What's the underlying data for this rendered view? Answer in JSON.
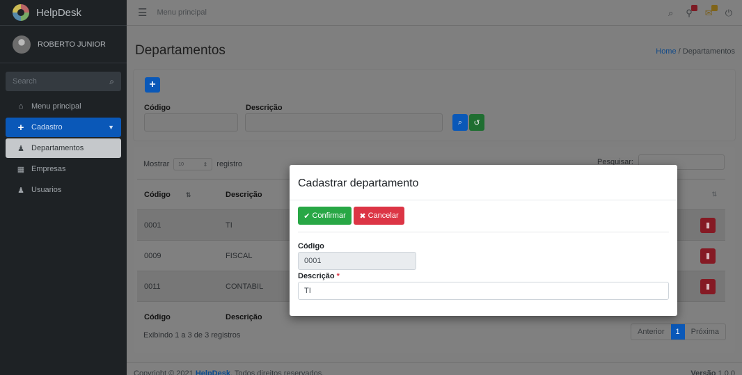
{
  "app": {
    "name": "HelpDesk"
  },
  "sidebar": {
    "user": "ROBERTO JUNIOR",
    "search_placeholder": "Search",
    "items": [
      {
        "label": "Menu principal",
        "icon": "home-icon"
      },
      {
        "label": "Cadastro",
        "icon": "plus-icon"
      },
      {
        "label": "Departamentos",
        "icon": "users-icon"
      },
      {
        "label": "Empresas",
        "icon": "building-icon"
      },
      {
        "label": "Usuarios",
        "icon": "user-plus-icon"
      }
    ]
  },
  "topbar": {
    "menu_label": "Menu principal"
  },
  "page": {
    "title": "Departamentos",
    "breadcrumb_home": "Home",
    "breadcrumb_sep": "/",
    "breadcrumb_current": "Departamentos"
  },
  "filter": {
    "add_symbol": "+",
    "codigo_label": "Código",
    "descricao_label": "Descrição"
  },
  "table": {
    "show_label": "Mostrar",
    "page_size": "10",
    "records_label": "registro",
    "search_label": "Pesquisar:",
    "columns": [
      "Código",
      "Descrição"
    ],
    "rows": [
      {
        "codigo": "0001",
        "descricao": "TI"
      },
      {
        "codigo": "0009",
        "descricao": "FISCAL"
      },
      {
        "codigo": "0011",
        "descricao": "CONTABIL"
      }
    ],
    "footer_columns": [
      "Código",
      "Descrição"
    ],
    "info": "Exibindo 1 a 3 de 3 registros",
    "pagination": {
      "prev": "Anterior",
      "current": "1",
      "next": "Próxima"
    }
  },
  "footer": {
    "prefix": "Copyright © 2021",
    "brand": "HelpDesk",
    "suffix": ". Todos direitos reservados.",
    "version_label": "Versão",
    "version": "1.0.0"
  },
  "modal": {
    "title": "Cadastrar departamento",
    "confirm_label": "Confirmar",
    "cancel_label": "Cancelar",
    "codigo_label": "Código",
    "codigo_value": "0001",
    "descricao_label": "Descrição",
    "required_mark": "*",
    "descricao_value": "TI"
  },
  "colors": {
    "primary": "#007bff",
    "success": "#28a745",
    "danger": "#dc3545",
    "sidebar": "#343a40"
  }
}
